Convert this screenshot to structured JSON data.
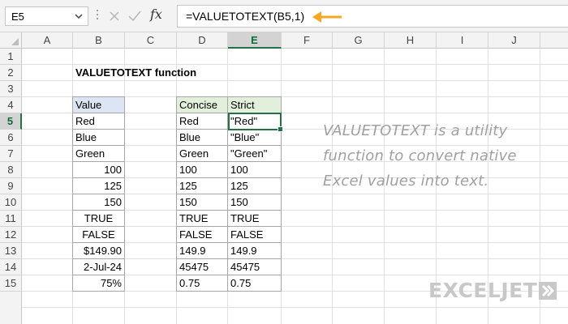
{
  "name_box": {
    "value": "E5"
  },
  "formula_bar": {
    "fx_label": "fx",
    "formula": "=VALUETOTEXT(B5,1)"
  },
  "columns": [
    "A",
    "B",
    "C",
    "D",
    "E",
    "F",
    "G",
    "H",
    "I",
    "J"
  ],
  "rows": [
    "1",
    "2",
    "3",
    "4",
    "5",
    "6",
    "7",
    "8",
    "9",
    "10",
    "11",
    "12",
    "13",
    "14",
    "15"
  ],
  "selected_cell": "E5",
  "title": "VALUETOTEXT function",
  "value_table": {
    "header": "Value",
    "items": [
      "Red",
      "Blue",
      "Green",
      "100",
      "125",
      "150",
      "TRUE",
      "FALSE",
      "$149.90",
      "2-Jul-24",
      "75%"
    ]
  },
  "result_table": {
    "headers": [
      "Concise",
      "Strict"
    ],
    "rows": [
      [
        "Red",
        "\"Red\""
      ],
      [
        "Blue",
        "\"Blue\""
      ],
      [
        "Green",
        "\"Green\""
      ],
      [
        "100",
        "100"
      ],
      [
        "125",
        "125"
      ],
      [
        "150",
        "150"
      ],
      [
        "TRUE",
        "TRUE"
      ],
      [
        "FALSE",
        "FALSE"
      ],
      [
        "149.9",
        "149.9"
      ],
      [
        "45475",
        "45475"
      ],
      [
        "0.75",
        "0.75"
      ]
    ]
  },
  "note": {
    "line1": "VALUETOTEXT is a utility",
    "line2": "function to convert native",
    "line3": "Excel values into text."
  },
  "logo": {
    "text": "EXCELJET"
  },
  "colors": {
    "accent": "#217346",
    "arrow": "#f5a623",
    "value_header": "#dbe5f3",
    "result_header": "#e2efda"
  }
}
